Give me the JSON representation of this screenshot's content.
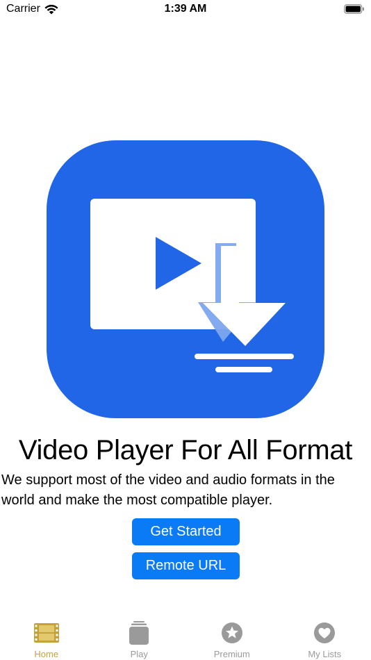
{
  "status_bar": {
    "carrier": "Carrier",
    "time": "1:39 AM"
  },
  "app_icon": {
    "name": "video-download-icon",
    "background_color": "#2066e6"
  },
  "main": {
    "title": "Video Player For All Format",
    "description": "We support most of the video and audio formats in the world and make the most compatible player.",
    "buttons": {
      "get_started": "Get Started",
      "remote_url": "Remote URL"
    },
    "button_color": "#0a7bf5"
  },
  "tab_bar": {
    "active_color": "#c4a23a",
    "inactive_color": "#9a9a9a",
    "items": [
      {
        "label": "Home",
        "icon": "film-icon",
        "active": true
      },
      {
        "label": "Play",
        "icon": "stack-icon",
        "active": false
      },
      {
        "label": "Premium",
        "icon": "star-circle-icon",
        "active": false
      },
      {
        "label": "My Lists",
        "icon": "heart-circle-icon",
        "active": false
      }
    ]
  }
}
